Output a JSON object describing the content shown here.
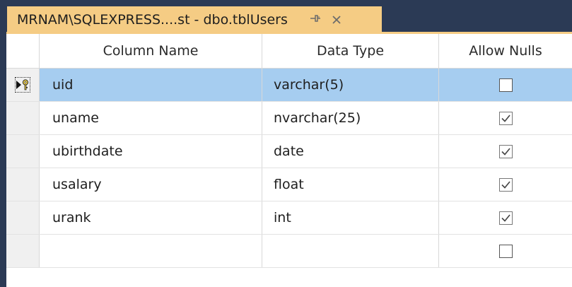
{
  "tab": {
    "title": "MRNAM\\SQLEXPRESS....st - dbo.tblUsers",
    "pin_glyph": "⇥",
    "close_glyph": "✕"
  },
  "columns": {
    "name": "Column Name",
    "type": "Data Type",
    "nulls": "Allow Nulls"
  },
  "rows": [
    {
      "name": "uid",
      "type": "varchar(5)",
      "allow_nulls": false,
      "primary_key": true,
      "selected": true
    },
    {
      "name": "uname",
      "type": "nvarchar(25)",
      "allow_nulls": true
    },
    {
      "name": "ubirthdate",
      "type": "date",
      "allow_nulls": true
    },
    {
      "name": "usalary",
      "type": "float",
      "allow_nulls": true
    },
    {
      "name": "urank",
      "type": "int",
      "allow_nulls": true
    },
    {
      "name": "",
      "type": "",
      "allow_nulls": false
    }
  ],
  "colors": {
    "tab_well": "#2b3a55",
    "tab_active": "#f5cc84",
    "row_selected": "#a6cdf0"
  }
}
